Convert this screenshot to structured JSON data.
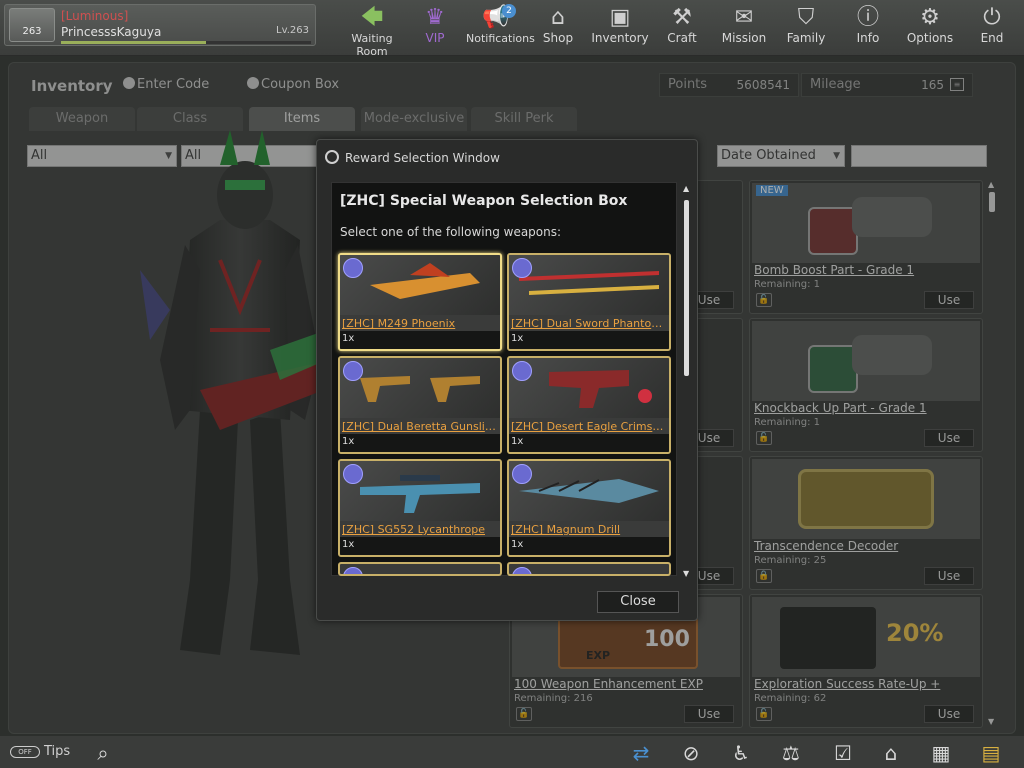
{
  "profile": {
    "rank_badge": "263",
    "clan": "[Luminous]",
    "name": "PrincesssKaguya",
    "level": "Lv.263",
    "xp_progress": 0.58
  },
  "nav": {
    "waiting_room": "Waiting Room",
    "vip": "VIP",
    "notifications": "Notifications",
    "notifications_badge": "2",
    "shop": "Shop",
    "inventory": "Inventory",
    "craft": "Craft",
    "mission": "Mission",
    "family": "Family",
    "info": "Info",
    "options": "Options",
    "end": "End"
  },
  "inventory": {
    "title": "Inventory",
    "enter_code": "Enter Code",
    "coupon_box": "Coupon Box",
    "points_label": "Points",
    "points_value": "5608541",
    "mileage_label": "Mileage",
    "mileage_value": "165",
    "tabs": [
      "Weapon",
      "Class",
      "Items",
      "Mode-exclusive",
      "Skill Perk"
    ],
    "filter1": "All",
    "filter2": "All",
    "sort": "Date Obtained"
  },
  "items": [
    {
      "name": "Bomb Boost Part - Grade 1",
      "remaining": "Remaining: 1",
      "use": "Use",
      "new": "NEW"
    },
    {
      "name": "Knockback Up Part - Grade 1",
      "remaining": "Remaining: 1",
      "use": "Use"
    },
    {
      "name": "Transcendence Decoder",
      "remaining": "Remaining: 25",
      "use": "Use"
    },
    {
      "name": "100 Weapon Enhancement EXP",
      "remaining": "Remaining: 216",
      "use": "Use",
      "thumb_text": "100",
      "thumb_sub": "EXP"
    },
    {
      "name": "Exploration Success Rate-Up +",
      "remaining": "Remaining: 62",
      "use": "Use",
      "thumb_text": "20%"
    }
  ],
  "left_col_use": [
    "Use",
    "Use",
    "Use"
  ],
  "modal": {
    "title": "Reward Selection Window",
    "box_title": "[ZHC] Special Weapon Selection Box",
    "subtitle": "Select one of the following weapons:",
    "weapons": [
      {
        "name": "[ZHC] M249 Phoenix",
        "qty": "1x"
      },
      {
        "name": "[ZHC] Dual Sword Phantom Sl...",
        "qty": "1x"
      },
      {
        "name": "[ZHC] Dual Beretta Gunslinger",
        "qty": "1x"
      },
      {
        "name": "[ZHC] Desert Eagle Crimson Hu...",
        "qty": "1x"
      },
      {
        "name": "[ZHC] SG552 Lycanthrope",
        "qty": "1x"
      },
      {
        "name": "[ZHC] Magnum Drill",
        "qty": "1x"
      }
    ],
    "close": "Close"
  },
  "bottom": {
    "tips": "Tips",
    "toggle": "OFF"
  },
  "colors": {
    "accent_gold": "#f0dc88",
    "weapon_name": "#e8a040",
    "clan_red": "#d05050",
    "vip_purple": "#a06ad0"
  }
}
